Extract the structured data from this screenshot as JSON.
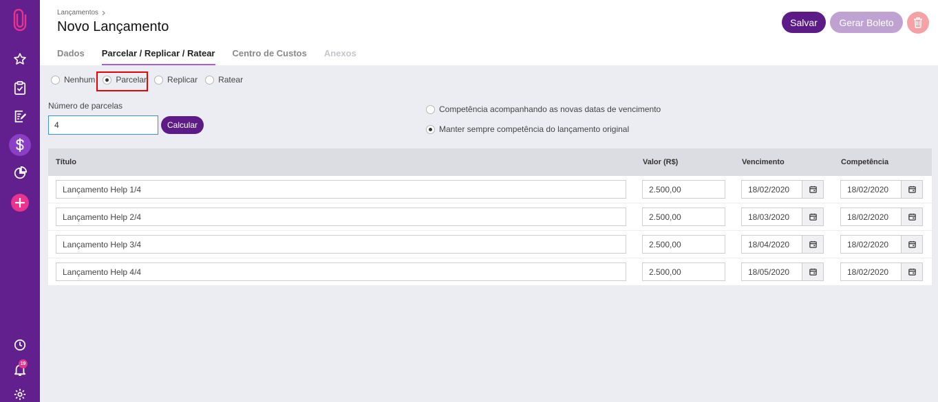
{
  "sidebar": {
    "notification_count": "19"
  },
  "header": {
    "breadcrumb": "Lançamentos",
    "title": "Novo Lançamento",
    "save_label": "Salvar",
    "boleto_label": "Gerar Boleto"
  },
  "tabs": [
    {
      "label": "Dados"
    },
    {
      "label": "Parcelar / Replicar / Ratear"
    },
    {
      "label": "Centro de Custos"
    },
    {
      "label": "Anexos"
    }
  ],
  "mode_options": [
    {
      "label": "Nenhum"
    },
    {
      "label": "Parcelar"
    },
    {
      "label": "Replicar"
    },
    {
      "label": "Ratear"
    }
  ],
  "parcelas": {
    "label": "Número de parcelas",
    "value": "4",
    "calc_label": "Calcular"
  },
  "competencia_options": [
    {
      "label": "Competência acompanhando as novas datas de vencimento"
    },
    {
      "label": "Manter sempre competência do lançamento original"
    }
  ],
  "table": {
    "headers": {
      "titulo": "Título",
      "valor": "Valor (R$)",
      "vencimento": "Vencimento",
      "competencia": "Competência"
    },
    "rows": [
      {
        "titulo": "Lançamento Help 1/4",
        "valor": "2.500,00",
        "vencimento": "18/02/2020",
        "competencia": "18/02/2020"
      },
      {
        "titulo": "Lançamento Help 2/4",
        "valor": "2.500,00",
        "vencimento": "18/03/2020",
        "competencia": "18/02/2020"
      },
      {
        "titulo": "Lançamento Help 3/4",
        "valor": "2.500,00",
        "vencimento": "18/04/2020",
        "competencia": "18/02/2020"
      },
      {
        "titulo": "Lançamento Help 4/4",
        "valor": "2.500,00",
        "vencimento": "18/05/2020",
        "competencia": "18/02/2020"
      }
    ]
  },
  "colors": {
    "sidebar": "#621f8e",
    "primary": "#5c1b86",
    "accent": "#e9338f",
    "highlight": "#e00000"
  }
}
